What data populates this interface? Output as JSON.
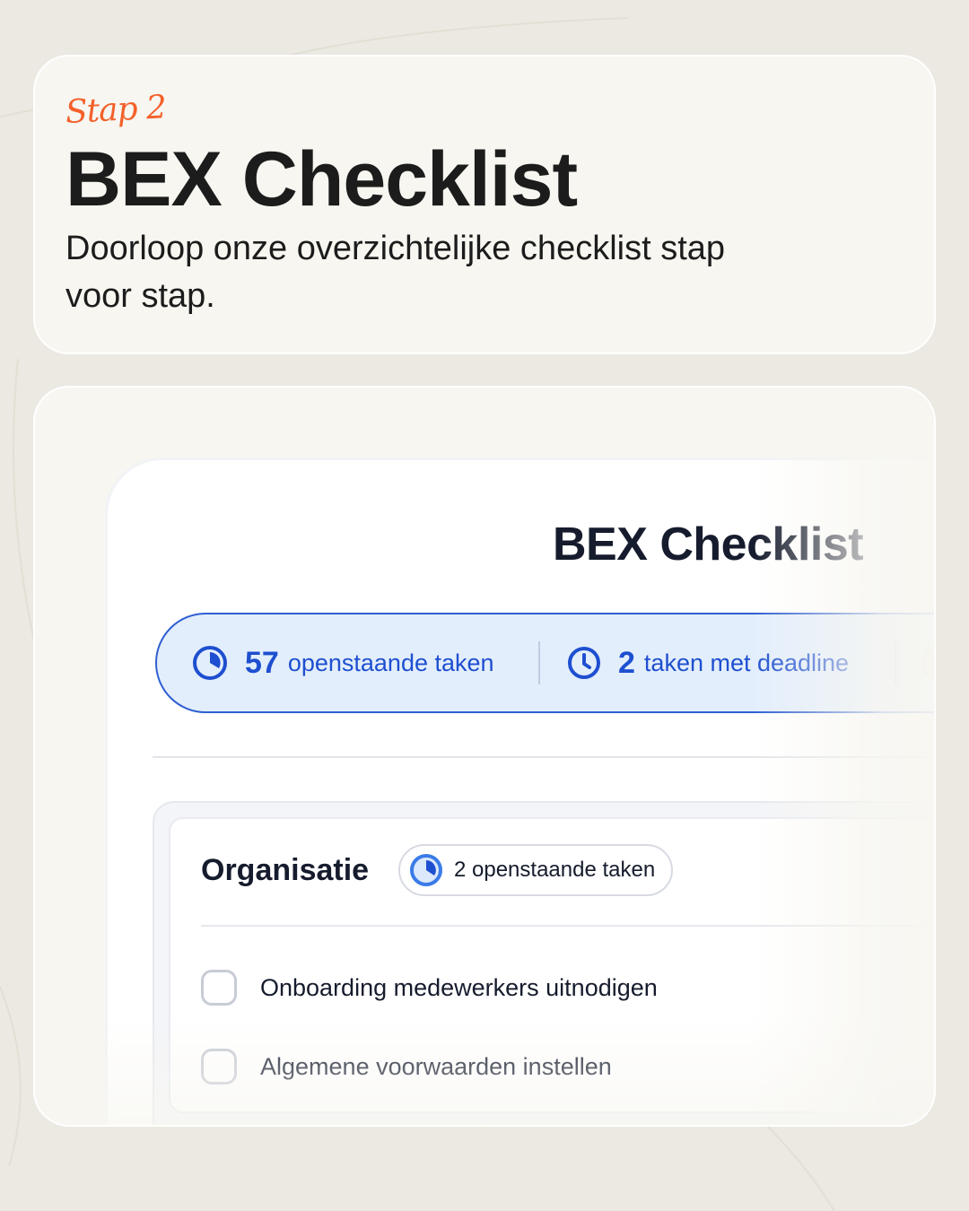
{
  "header": {
    "step": "Stap 2",
    "title": "BEX Checklist",
    "subtitle": "Doorloop onze overzichtelijke checklist stap voor stap."
  },
  "app": {
    "title": "BEX Checklist",
    "stats": {
      "open_count": "57",
      "open_label": "openstaande taken",
      "deadline_count": "2",
      "deadline_label": "taken met deadline"
    },
    "section": {
      "title": "Organisatie",
      "badge": "2 openstaande taken",
      "tasks": [
        {
          "label": "Onboarding medewerkers uitnodigen",
          "checked": false
        },
        {
          "label": "Algemene voorwaarden instellen",
          "checked": false
        }
      ]
    }
  },
  "colors": {
    "accent": "#f4602a",
    "primary_blue": "#1e4fd0",
    "background": "#ebe9e1"
  },
  "icons": [
    "pie-progress-icon",
    "clock-icon",
    "avatar"
  ]
}
